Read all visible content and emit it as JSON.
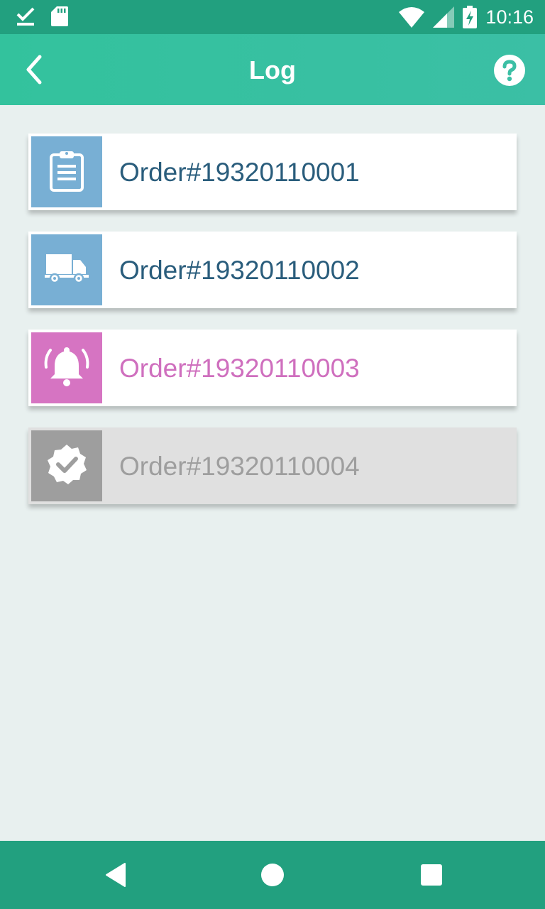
{
  "status_bar": {
    "time": "10:16",
    "icons": [
      "download-done-icon",
      "sd-card-icon",
      "wifi-icon",
      "signal-icon",
      "battery-charging-icon"
    ]
  },
  "app_bar": {
    "title": "Log",
    "back_icon": "chevron-left-icon",
    "help_icon": "help-circle-icon"
  },
  "orders": [
    {
      "label": "Order#19320110001",
      "icon": "clipboard-icon",
      "icon_bg": "#78afd4",
      "text_color": "#2a5d7c"
    },
    {
      "label": "Order#19320110002",
      "icon": "truck-icon",
      "icon_bg": "#78afd4",
      "text_color": "#2a5d7c"
    },
    {
      "label": "Order#19320110003",
      "icon": "bell-alert-icon",
      "icon_bg": "#d674c2",
      "text_color": "#cf6fbe"
    },
    {
      "label": "Order#19320110004",
      "icon": "verified-check-icon",
      "icon_bg": "#9e9e9e",
      "text_color": "#9e9e9e"
    }
  ],
  "nav_bar": {
    "icons": [
      "back-triangle-icon",
      "home-circle-icon",
      "recents-square-icon"
    ]
  },
  "colors": {
    "status_bar": "#22a07f",
    "app_bar": "#33c29d",
    "background": "#e8f0ef",
    "nav_bar": "#22a07f"
  }
}
